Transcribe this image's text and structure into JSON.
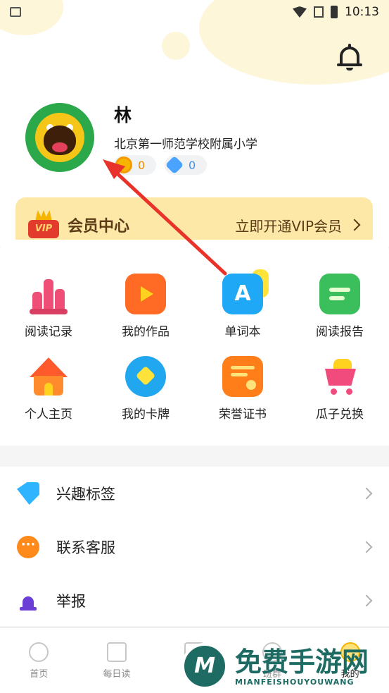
{
  "status_bar": {
    "time": "10:13"
  },
  "profile": {
    "name": "林",
    "school": "北京第一师范学校附属小学",
    "coins": "0",
    "gems": "0"
  },
  "vip": {
    "badge": "VIP",
    "title": "会员中心",
    "cta": "立即开通VIP会员"
  },
  "grid": [
    {
      "label": "阅读记录",
      "icon": "bar-chart-icon"
    },
    {
      "label": "我的作品",
      "icon": "tv-play-icon"
    },
    {
      "label": "单词本",
      "icon": "letter-a-icon"
    },
    {
      "label": "阅读报告",
      "icon": "report-icon"
    },
    {
      "label": "个人主页",
      "icon": "home-icon"
    },
    {
      "label": "我的卡牌",
      "icon": "flower-heart-icon"
    },
    {
      "label": "荣誉证书",
      "icon": "certificate-icon"
    },
    {
      "label": "瓜子兑换",
      "icon": "cart-icon"
    }
  ],
  "list": [
    {
      "label": "兴趣标签",
      "icon": "tag-icon"
    },
    {
      "label": "联系客服",
      "icon": "chat-icon"
    },
    {
      "label": "举报",
      "icon": "alarm-icon"
    }
  ],
  "tabs": [
    {
      "label": "首页"
    },
    {
      "label": "每日读"
    },
    {
      "label": "阅读"
    },
    {
      "label": "班群"
    },
    {
      "label": "我的"
    }
  ],
  "watermark": {
    "cn": "免费手游网",
    "en": "MIANFEISHOUYOUWANG"
  },
  "colors": {
    "vip_bg": "#fde8a8",
    "arrow": "#e8322a",
    "accent": "#f5b400"
  }
}
